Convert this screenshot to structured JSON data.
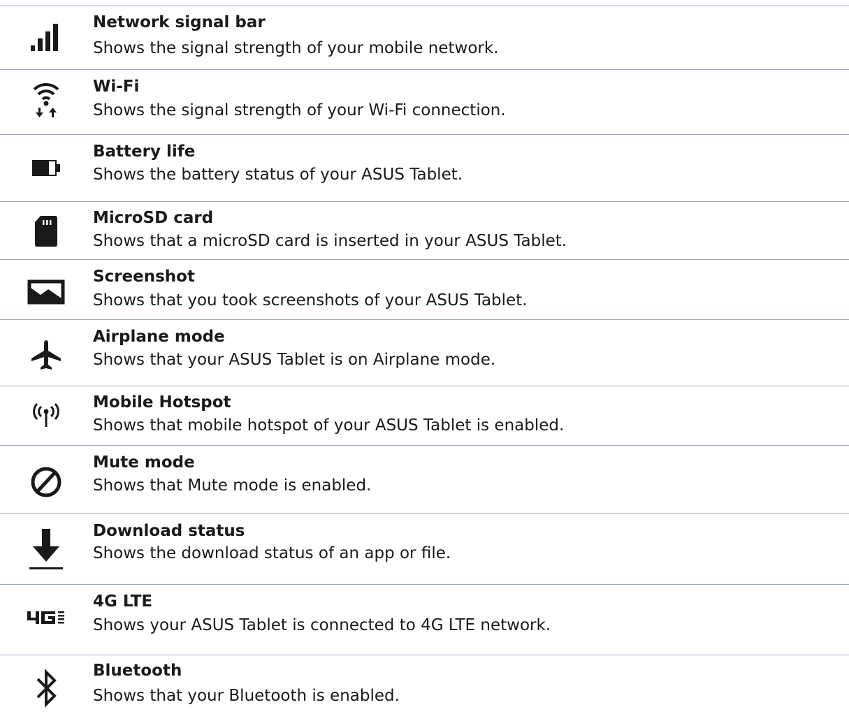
{
  "items": [
    {
      "icon": "signal-bars-icon",
      "title": "Network signal bar",
      "desc": "Shows the signal strength of your mobile network."
    },
    {
      "icon": "wifi-icon",
      "title": "Wi-Fi",
      "desc": "Shows the signal strength of your Wi-Fi connection."
    },
    {
      "icon": "battery-icon",
      "title": "Battery life",
      "desc": "Shows the battery status of your ASUS Tablet."
    },
    {
      "icon": "sd-card-icon",
      "title": "MicroSD card",
      "desc": "Shows that a microSD card is inserted in your ASUS Tablet."
    },
    {
      "icon": "screenshot-icon",
      "title": "Screenshot",
      "desc": "Shows that you took screenshots of your ASUS Tablet."
    },
    {
      "icon": "airplane-icon",
      "title": "Airplane mode",
      "desc": "Shows that your ASUS Tablet is on Airplane mode."
    },
    {
      "icon": "hotspot-icon",
      "title": "Mobile Hotspot",
      "desc": "Shows that mobile hotspot of your ASUS Tablet is enabled."
    },
    {
      "icon": "mute-icon",
      "title": "Mute mode",
      "desc": "Shows that Mute mode is enabled."
    },
    {
      "icon": "download-icon",
      "title": "Download status",
      "desc": "Shows the download status of an app or file."
    },
    {
      "icon": "4g-lte-icon",
      "title": "4G LTE",
      "desc": "Shows your ASUS Tablet is connected to 4G LTE network."
    },
    {
      "icon": "bluetooth-icon",
      "title": "Bluetooth",
      "desc": "Shows that your Bluetooth is enabled."
    }
  ],
  "colors": {
    "divider": "#9aa5bf",
    "icon": "#1a1a1a",
    "text": "#1a1a1a"
  }
}
